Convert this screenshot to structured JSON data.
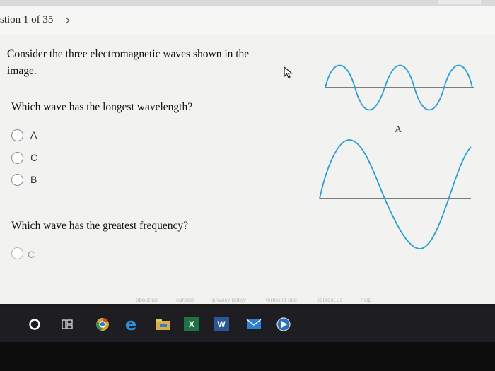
{
  "nav": {
    "question_counter": "stion 1 of 35",
    "next_icon": "chevron-right-icon"
  },
  "question1": {
    "text": "Consider the three electromagnetic waves shown in the image."
  },
  "question2": {
    "text": "Which wave has the longest wavelength?",
    "options": [
      "A",
      "C",
      "B"
    ]
  },
  "question3": {
    "text": "Which wave has the greatest frequency?",
    "first_option_partial": "C"
  },
  "waves": {
    "label_a": "A",
    "colors": {
      "wave": "#2a9fd0",
      "axis": "#555555"
    }
  },
  "footer": {
    "links": [
      "about us",
      "careers",
      "privacy policy",
      "terms of use",
      "contact us",
      "help"
    ]
  },
  "taskbar": {
    "icons": [
      "start-circle-icon",
      "task-view-icon",
      "chrome-icon",
      "edge-icon",
      "file-explorer-icon",
      "excel-icon",
      "word-icon",
      "mail-icon",
      "media-player-icon"
    ],
    "letters": {
      "excel": "X",
      "word": "W"
    }
  }
}
